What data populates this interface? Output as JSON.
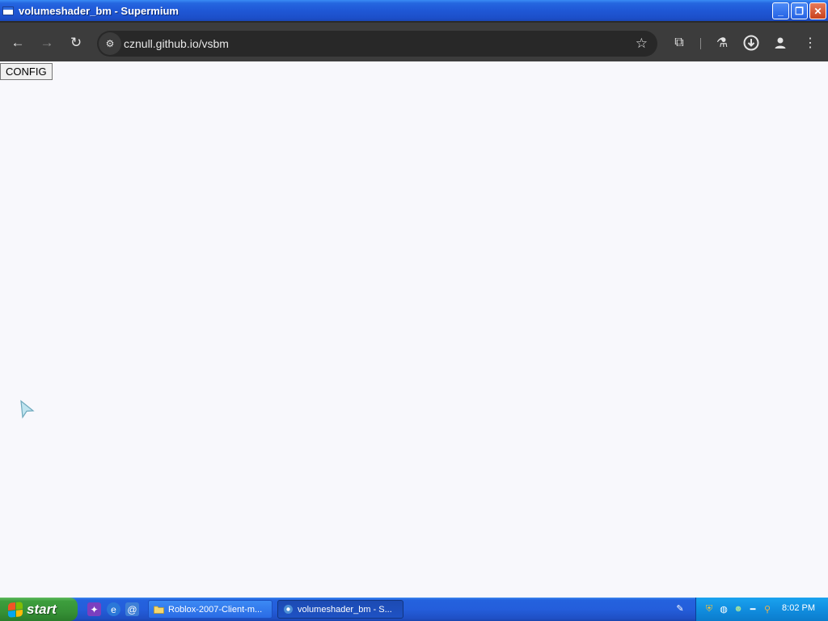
{
  "window": {
    "title": "volumeshader_bm - Supermium",
    "minimize_glyph": "_",
    "restore_glyph": "❐",
    "close_glyph": "✕"
  },
  "browser": {
    "back_icon": "←",
    "forward_icon": "→",
    "reload_icon": "↻",
    "site_settings_icon": "⚙",
    "url": "cznull.github.io/vsbm",
    "bookmark_icon": "☆",
    "extensions_icon": "⧉",
    "labs_icon": "⚗",
    "download_icon": "⇩",
    "profile_icon": "●",
    "menu_icon": "⋮"
  },
  "page": {
    "config_button_label": "CONFIG"
  },
  "taskbar": {
    "start_label": "start",
    "quick_launch": [
      "messenger-icon",
      "internet-explorer-icon",
      "outlook-express-icon"
    ],
    "tasks": [
      {
        "label": "Roblox-2007-Client-m...",
        "icon": "folder-icon",
        "active": false
      },
      {
        "label": "volumeshader_bm - S...",
        "icon": "supermium-icon",
        "active": true
      }
    ],
    "tray_icons": [
      "pen-icon",
      "security-shield-icon",
      "network-icon",
      "people-icon",
      "volume-icon",
      "search-icon"
    ],
    "clock": "8:02 PM"
  },
  "colors": {
    "titlebar": "#1f58d6",
    "browser_toolbar": "#3c3c3c",
    "omnibox": "#282828",
    "page_background": "#f8f8fc",
    "taskbar": "#245edb",
    "start_button": "#369136",
    "tray": "#118ee0"
  }
}
